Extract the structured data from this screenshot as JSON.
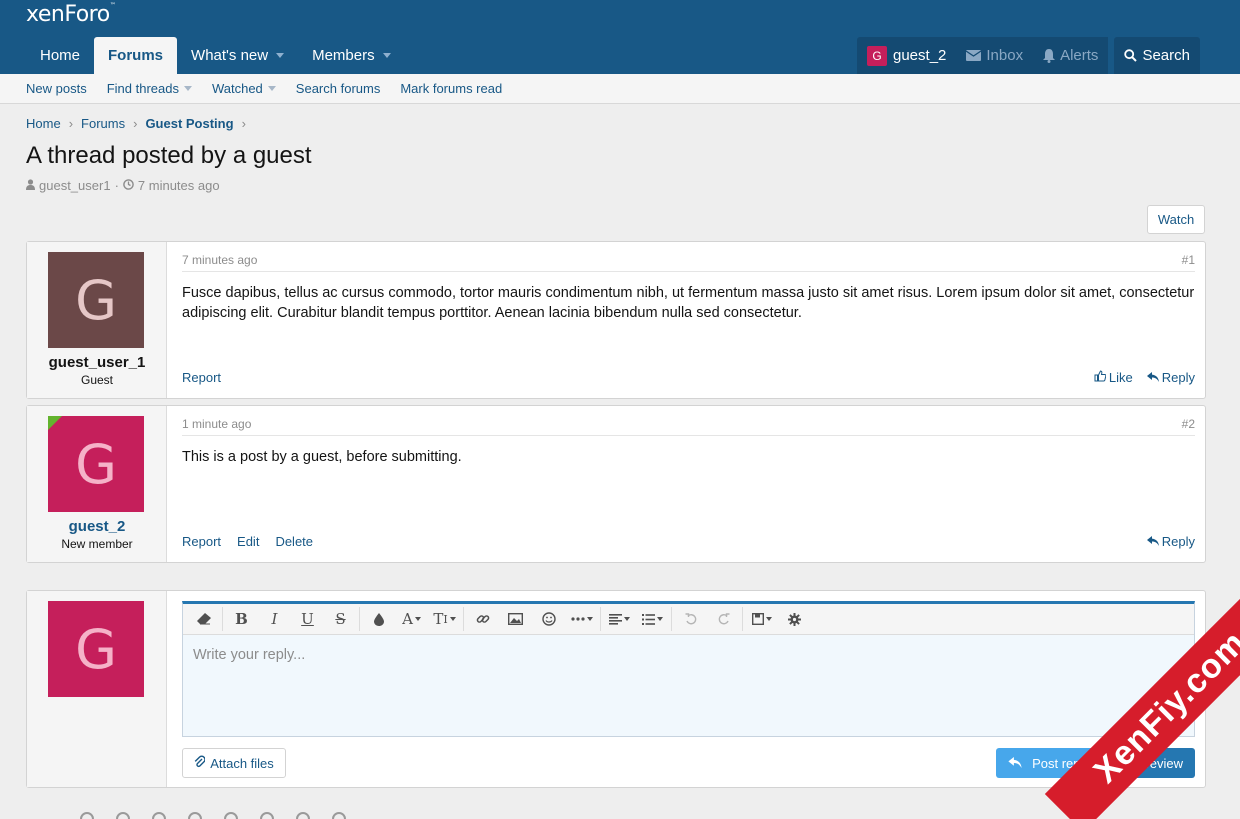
{
  "header": {
    "logo": "xenForo",
    "logo_mark": "™",
    "tabs": [
      {
        "label": "Home",
        "active": false,
        "dropdown": false
      },
      {
        "label": "Forums",
        "active": true,
        "dropdown": false
      },
      {
        "label": "What's new",
        "active": false,
        "dropdown": true
      },
      {
        "label": "Members",
        "active": false,
        "dropdown": true
      }
    ],
    "user": {
      "initial": "G",
      "name": "guest_2"
    },
    "inbox": "Inbox",
    "alerts": "Alerts",
    "search": "Search"
  },
  "subnav": {
    "items": [
      {
        "label": "New posts",
        "dropdown": false
      },
      {
        "label": "Find threads",
        "dropdown": true
      },
      {
        "label": "Watched",
        "dropdown": true
      },
      {
        "label": "Search forums",
        "dropdown": false
      },
      {
        "label": "Mark forums read",
        "dropdown": false
      }
    ]
  },
  "breadcrumb": [
    "Home",
    "Forums",
    "Guest Posting"
  ],
  "thread": {
    "title": "A thread posted by a guest",
    "author": "guest_user1",
    "time": "7 minutes ago",
    "watch": "Watch"
  },
  "posts": [
    {
      "initial": "G",
      "username": "guest_user_1",
      "usertitle": "Guest",
      "time": "7 minutes ago",
      "number": "#1",
      "body": "Fusce dapibus, tellus ac cursus commodo, tortor mauris condimentum nibh, ut fermentum massa justo sit amet risus. Lorem ipsum dolor sit amet, consectetur adipiscing elit. Curabitur blandit tempus porttitor. Aenean lacinia bibendum nulla sed consectetur.",
      "report": "Report",
      "like": "Like",
      "reply": "Reply"
    },
    {
      "initial": "G",
      "username": "guest_2",
      "usertitle": "New member",
      "time": "1 minute ago",
      "number": "#2",
      "body": "This is a post by a guest, before submitting.",
      "report": "Report",
      "edit": "Edit",
      "delete": "Delete",
      "reply": "Reply"
    }
  ],
  "reply_box": {
    "initial": "G",
    "placeholder": "Write your reply...",
    "attach": "Attach files",
    "post_reply": "Post reply",
    "preview": "Preview",
    "toolbar": {
      "bold": "B",
      "italic": "I",
      "underline": "U",
      "strike": "S",
      "font": "A",
      "size": "T"
    }
  },
  "watermark": "XenFiy.com",
  "colors": {
    "header_bg": "#185886",
    "link": "#185886",
    "avatar_pink": "#c51f5b",
    "avatar_brown": "#6b4848",
    "post_reply": "#47a7eb",
    "preview": "#2577b1",
    "online": "#63b32e"
  }
}
